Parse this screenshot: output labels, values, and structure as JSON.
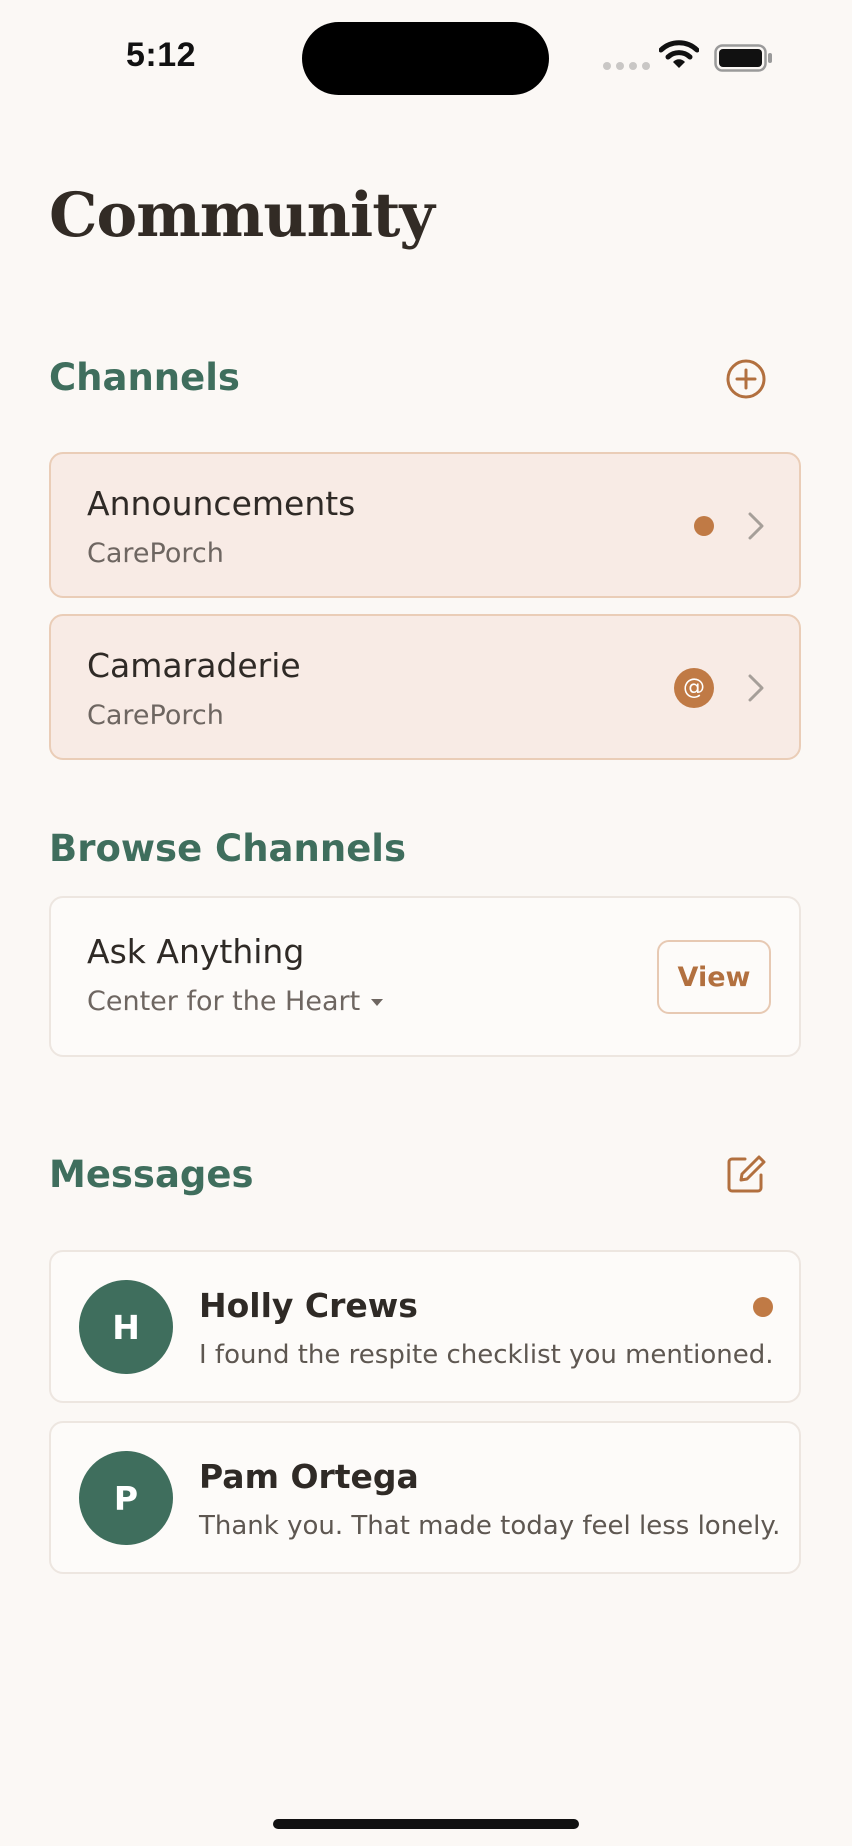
{
  "status_bar": {
    "time": "5:12"
  },
  "page": {
    "title": "Community"
  },
  "channels": {
    "title": "Channels",
    "add_icon": "plus-circle-icon",
    "items": [
      {
        "name": "Announcements",
        "org": "CarePorch",
        "indicator": "unread-dot"
      },
      {
        "name": "Camaraderie",
        "org": "CarePorch",
        "indicator": "mention",
        "badge": "@"
      }
    ]
  },
  "browse": {
    "title": "Browse Channels",
    "items": [
      {
        "name": "Ask Anything",
        "org": "Center for the Heart",
        "action": "View"
      }
    ]
  },
  "messages": {
    "title": "Messages",
    "compose_icon": "compose-icon",
    "items": [
      {
        "initial": "H",
        "name": "Holly Crews",
        "preview": "I found the respite checklist you mentioned.",
        "unread": true
      },
      {
        "initial": "P",
        "name": "Pam Ortega",
        "preview": "Thank you. That made today feel less lonely.",
        "unread": false
      }
    ]
  },
  "colors": {
    "background": "#FBF8F5",
    "accent_green": "#3F6E5D",
    "accent_copper": "#C07A45",
    "joined_card": "#F8EBE5"
  }
}
